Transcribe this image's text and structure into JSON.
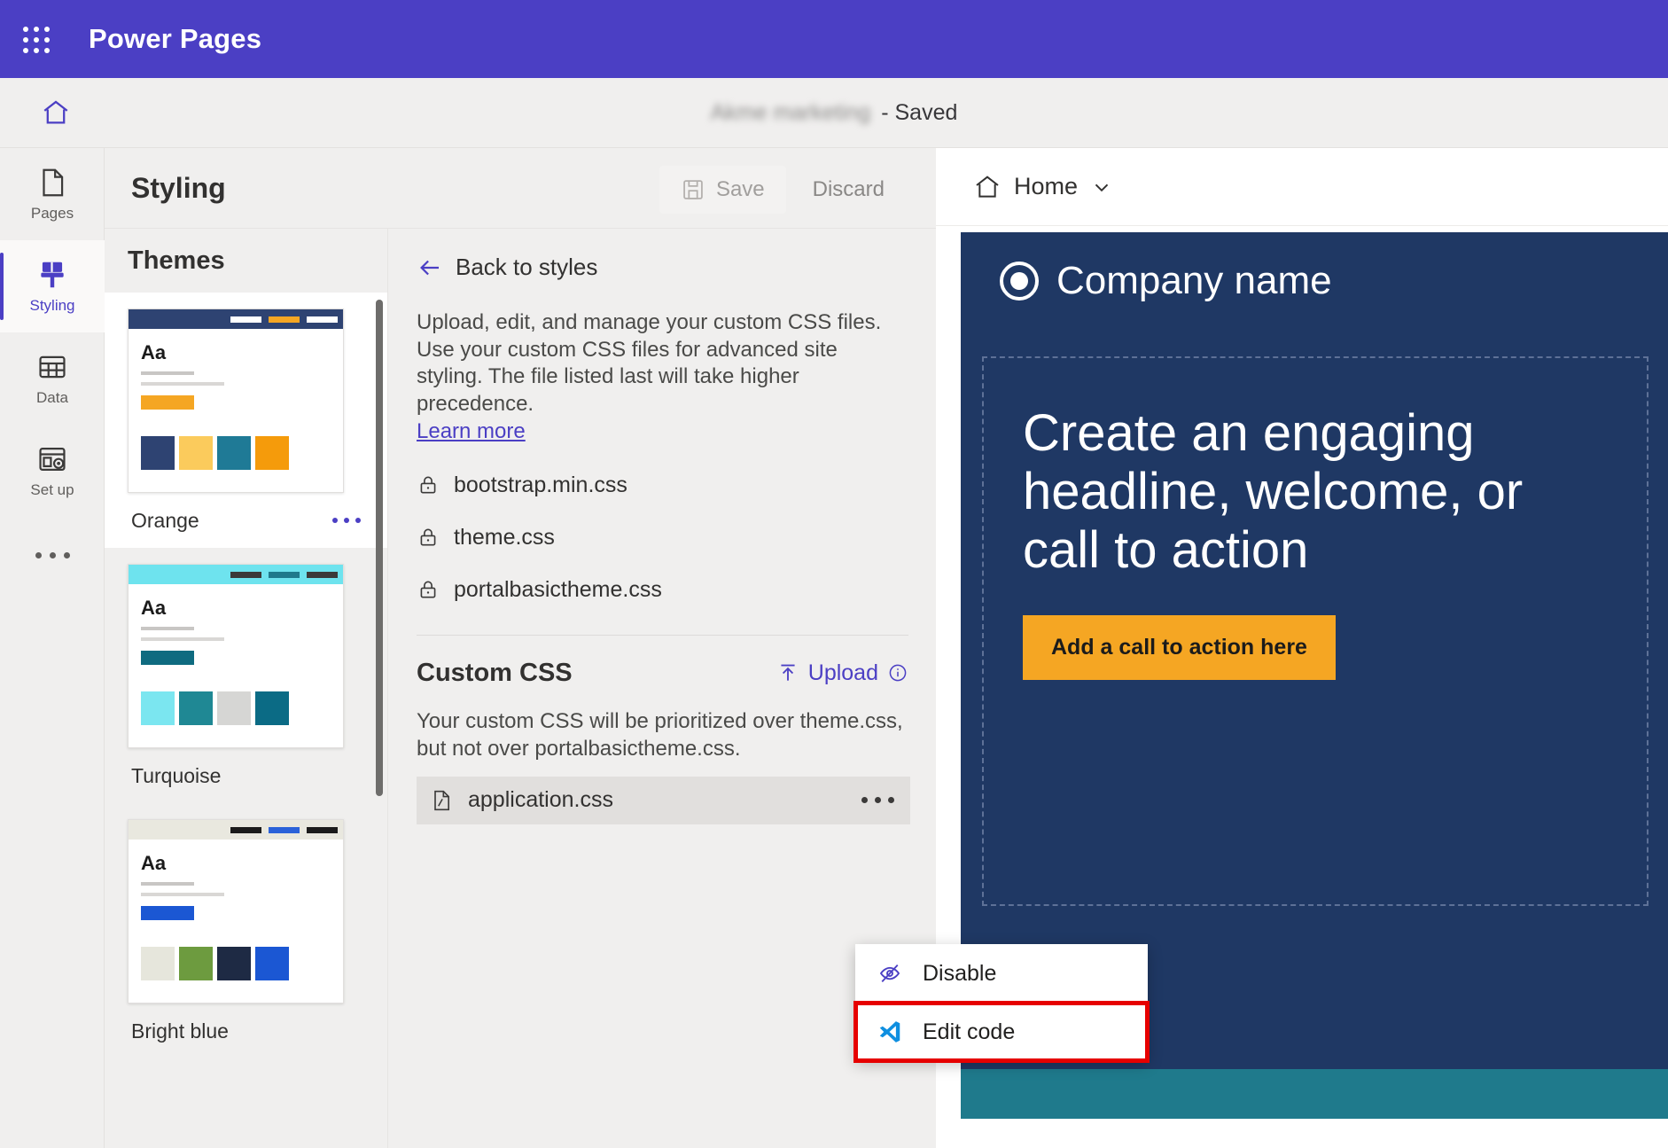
{
  "topbar": {
    "waffle_icon": "app-launcher-icon",
    "title": "Power Pages"
  },
  "sitebar": {
    "home_icon": "home-icon",
    "site_name": "Akme marketing",
    "status": "- Saved"
  },
  "rail": {
    "items": [
      {
        "label": "Pages",
        "icon": "page-icon",
        "active": false
      },
      {
        "label": "Styling",
        "icon": "paintbrush-icon",
        "active": true
      },
      {
        "label": "Data",
        "icon": "table-icon",
        "active": false
      },
      {
        "label": "Set up",
        "icon": "setup-icon",
        "active": false
      }
    ],
    "overflow": "more-icon"
  },
  "panel": {
    "title": "Styling",
    "save_label": "Save",
    "save_icon": "save-disk-icon",
    "discard_label": "Discard"
  },
  "themes": {
    "heading": "Themes",
    "ellipsis_icon": "more-icon",
    "items": [
      {
        "name": "Orange",
        "selected": true,
        "bar_color": "#2E4372",
        "segments": [
          "#FFFFFF",
          "#F5A623",
          "#FFFFFF"
        ],
        "sample_text": "Aa",
        "button_color": "#F5A623",
        "swatches": [
          "#2E4372",
          "#FBCB5C",
          "#1F7A96",
          "#F59B0B"
        ]
      },
      {
        "name": "Turquoise",
        "selected": false,
        "bar_color": "#6EE3EE",
        "segments": [
          "#3B3A39",
          "#1F7A8C",
          "#3B3A39"
        ],
        "sample_text": "Aa",
        "button_color": "#0F6B80",
        "swatches": [
          "#7BE6F0",
          "#1F8894",
          "#D6D6D4",
          "#0B6B85"
        ]
      },
      {
        "name": "Bright blue",
        "selected": false,
        "bar_color": "#E9E8DF",
        "segments": [
          "#1B1B1B",
          "#2B62D9",
          "#1B1B1B"
        ],
        "sample_text": "Aa",
        "button_color": "#1B57D3",
        "swatches": [
          "#E6E6DC",
          "#6D9B3F",
          "#1E2A44",
          "#1B57D3"
        ]
      }
    ]
  },
  "css_panel": {
    "back_label": "Back to styles",
    "back_icon": "arrow-left-icon",
    "description": "Upload, edit, and manage your custom CSS files. Use your custom CSS files for advanced site styling. The file listed last will take higher precedence.",
    "learn_more": "Learn more",
    "locked_files": [
      {
        "name": "bootstrap.min.css",
        "icon": "lock-icon"
      },
      {
        "name": "theme.css",
        "icon": "lock-icon"
      },
      {
        "name": "portalbasictheme.css",
        "icon": "lock-icon"
      }
    ],
    "custom_heading": "Custom CSS",
    "upload_label": "Upload",
    "upload_icon": "upload-icon",
    "info_icon": "info-circle-icon",
    "custom_description": "Your custom CSS will be prioritized over theme.css, but not over portalbasictheme.css.",
    "custom_file": {
      "name": "application.css",
      "icon": "css-file-icon",
      "menu_icon": "more-icon"
    }
  },
  "context_menu": {
    "items": [
      {
        "label": "Disable",
        "icon": "eye-off-icon",
        "highlighted": false
      },
      {
        "label": "Edit code",
        "icon": "vscode-icon",
        "highlighted": true
      }
    ],
    "highlight_color": "#E60000"
  },
  "preview": {
    "home_label": "Home",
    "home_icon": "home-icon",
    "chevron_icon": "chevron-down-icon",
    "logo_icon": "circle-logo-icon",
    "company_name": "Company name",
    "headline": "Create an engaging headline, welcome, or call to action",
    "cta_label": "Add a call to action here"
  },
  "colors": {
    "brand_purple": "#4B3FC4",
    "site_navy": "#1F3864",
    "cta_orange": "#F5A623",
    "band_teal": "#1F7A8C"
  }
}
